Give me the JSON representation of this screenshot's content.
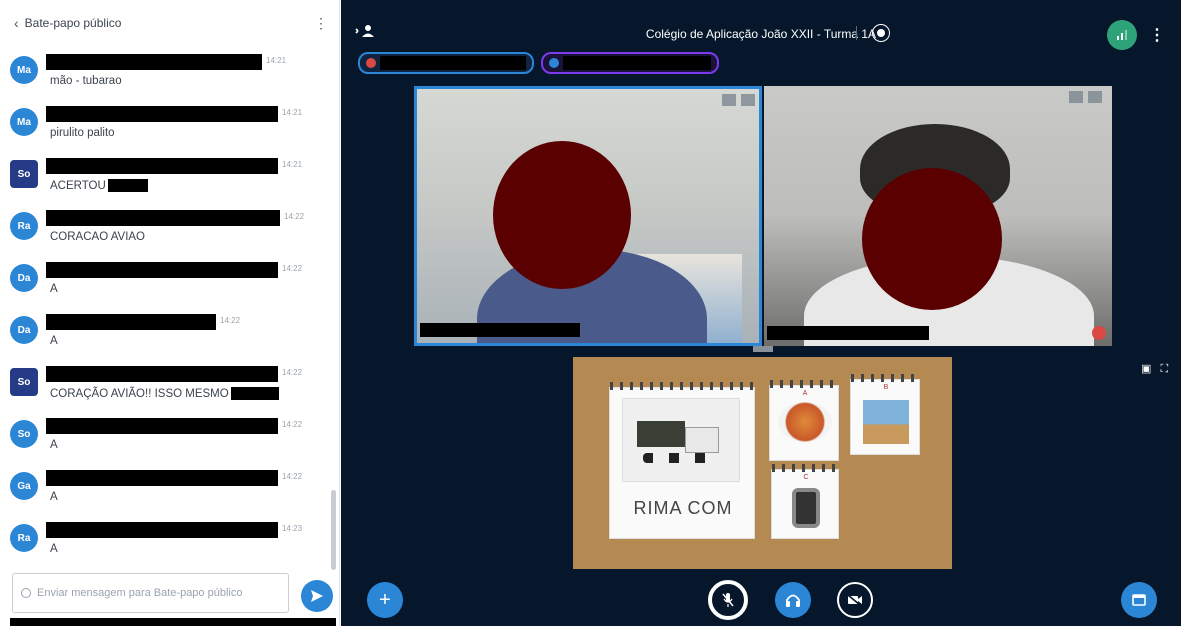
{
  "chat": {
    "back_icon": "chevron-left-icon",
    "title": "Bate-papo público",
    "menu_icon": "kebab-icon",
    "messages": [
      {
        "initials": "Ma",
        "avatar_shape": "round",
        "time": "14:21",
        "text": "mão - tubarao",
        "redact_after": false
      },
      {
        "initials": "Ma",
        "avatar_shape": "round",
        "time": "14:21",
        "text": "pirulito palito",
        "redact_after": false
      },
      {
        "initials": "So",
        "avatar_shape": "square",
        "time": "14:21",
        "text": "ACERTOU",
        "redact_after": true
      },
      {
        "initials": "Ra",
        "avatar_shape": "round",
        "time": "14:22",
        "text": "CORACAO AVIAO",
        "redact_after": false
      },
      {
        "initials": "Da",
        "avatar_shape": "round",
        "time": "14:22",
        "text": "A",
        "redact_after": false
      },
      {
        "initials": "Da",
        "avatar_shape": "round",
        "time": "14:22",
        "text": "A",
        "redact_after": false
      },
      {
        "initials": "So",
        "avatar_shape": "square",
        "time": "14:22",
        "text": "CORAÇÃO AVIÃO!! ISSO MESMO",
        "redact_after": true
      },
      {
        "initials": "So",
        "avatar_shape": "round",
        "time": "14:22",
        "text": "A",
        "redact_after": false
      },
      {
        "initials": "Ga",
        "avatar_shape": "round",
        "time": "14:22",
        "text": "A",
        "redact_after": false
      },
      {
        "initials": "Ra",
        "avatar_shape": "round",
        "time": "14:23",
        "text": "A",
        "redact_after": false
      }
    ],
    "composer_placeholder": "Enviar mensagem para Bate-papo público",
    "send_icon": "send-icon"
  },
  "meeting": {
    "title": "Colégio de Aplicação João XXII - Turma 1A",
    "record_icon": "record-icon",
    "connection_icon": "signal-icon",
    "users_icon": "users-toggle-icon",
    "presentation": {
      "card_text": "RIMA COM",
      "letters": [
        "A",
        "B",
        "C"
      ]
    }
  },
  "colors": {
    "accent": "#2b86d6",
    "meeting_bg": "#06172b",
    "connection_ok": "#2ea37a",
    "muted": "#d94a45"
  }
}
